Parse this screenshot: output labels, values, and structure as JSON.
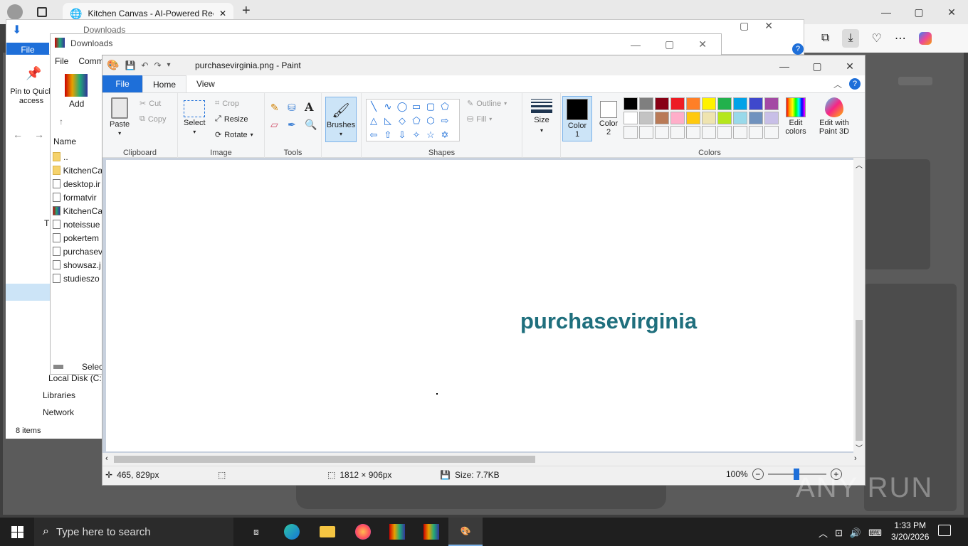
{
  "browser": {
    "tab_title": "Kitchen Canvas - AI-Powered Rec",
    "new_tab_label": "+",
    "win_min": "—",
    "win_max": "▢",
    "win_close": "✕"
  },
  "explorer": {
    "back_title": "Downloads",
    "title": "Downloads",
    "file_tab": "File",
    "menu": [
      "File",
      "Comm"
    ],
    "pin_label": "Pin to Quick access",
    "add_label": "Add",
    "col_name": "Name",
    "files": [
      ".. ",
      "KitchenCa",
      "desktop.ir",
      "formatvir",
      "KitchenCa",
      "noteissue",
      "pokertem",
      "purchasev",
      "showsaz.j",
      "studieszo"
    ],
    "nav": {
      "local_disk": "Local Disk (C:)",
      "libraries": "Libraries",
      "network": "Network",
      "this_pc": "Th"
    },
    "status_items": "8 items",
    "select_label": "Selec"
  },
  "paint": {
    "title": "purchasevirginia.png - Paint",
    "tabs": {
      "file": "File",
      "home": "Home",
      "view": "View"
    },
    "clipboard": {
      "paste": "Paste",
      "cut": "Cut",
      "copy": "Copy",
      "label": "Clipboard"
    },
    "image": {
      "select": "Select",
      "crop": "Crop",
      "resize": "Resize",
      "rotate": "Rotate",
      "label": "Image"
    },
    "tools": {
      "label": "Tools",
      "text": "A"
    },
    "brushes": "Brushes",
    "shapes": {
      "outline": "Outline",
      "fill": "Fill",
      "label": "Shapes"
    },
    "size": "Size",
    "color1": "Color 1",
    "color2": "Color 2",
    "colors_label": "Colors",
    "edit_colors": "Edit colors",
    "edit_3d": "Edit with Paint 3D",
    "palette_row1": [
      "#000000",
      "#7f7f7f",
      "#880015",
      "#ed1c24",
      "#ff7f27",
      "#fff200",
      "#22b14c",
      "#00a2e8",
      "#3f48cc",
      "#a349a4"
    ],
    "palette_row2": [
      "#ffffff",
      "#c3c3c3",
      "#b97a57",
      "#ffaec9",
      "#ffc90e",
      "#efe4b0",
      "#b5e61d",
      "#99d9ea",
      "#7092be",
      "#c8bfe7"
    ],
    "canvas_text": "purchasevirginia",
    "canvas_text_color": "#1f6f7d",
    "status": {
      "pos": "465, 829px",
      "dims": "1812 × 906px",
      "size": "Size: 7.7KB",
      "zoom": "100%"
    }
  },
  "taskbar": {
    "search": "Type here to search",
    "time": "1:33 PM",
    "date": "3/20/2026"
  },
  "watermark": "ANY RUN"
}
